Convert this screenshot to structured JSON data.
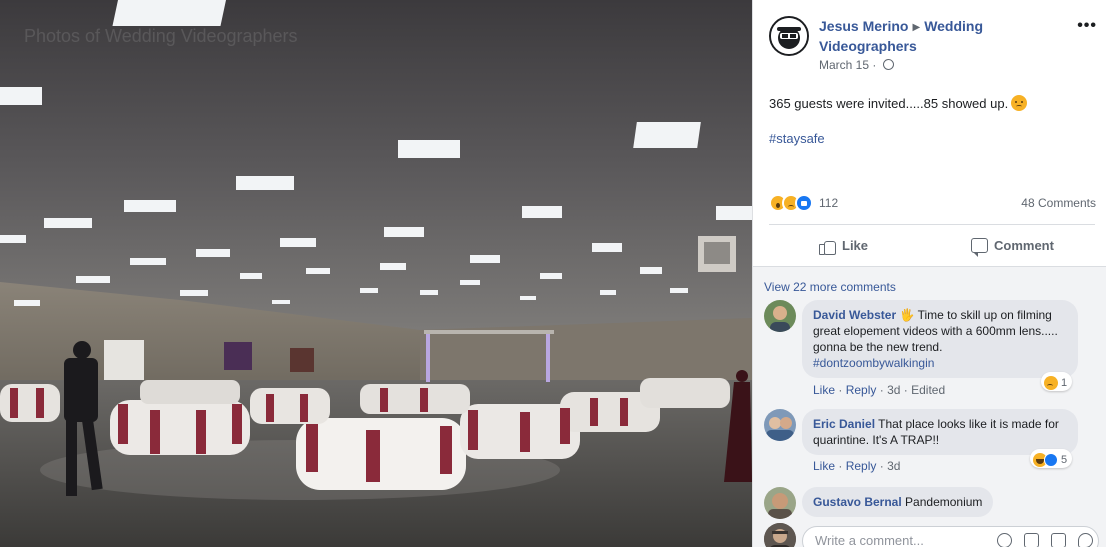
{
  "photo": {
    "watermark": "Photos of Wedding Videographers"
  },
  "post": {
    "author": "Jesus Merino",
    "group": "Wedding Videographers",
    "date": "March 15",
    "privacy_icon": "globe-icon",
    "more_icon": "more-icon",
    "more_label": "•••",
    "text": "365 guests were invited.....85 showed up.",
    "hashtag": "#staysafe",
    "reaction_count": "112",
    "comments_count": "48 Comments",
    "like_label": "Like",
    "comment_label": "Comment"
  },
  "comments": {
    "view_more": "View 22 more comments",
    "items": [
      {
        "name": "David Webster",
        "text": "Time to skill up on filming great elopement videos with a 600mm lens..... gonna be the new trend.",
        "tag": "#dontzoombywalkingin",
        "like": "Like",
        "reply": "Reply",
        "time": "3d",
        "edited": "Edited",
        "react_count": "1"
      },
      {
        "name": "Eric Daniel",
        "text": "That place looks like it is made for quarintine. It's A TRAP!!",
        "like": "Like",
        "reply": "Reply",
        "time": "3d",
        "react_count": "5"
      },
      {
        "name": "Gustavo Bernal",
        "text": "Pandemonium"
      }
    ],
    "write_placeholder": "Write a comment...",
    "dot": "·"
  }
}
